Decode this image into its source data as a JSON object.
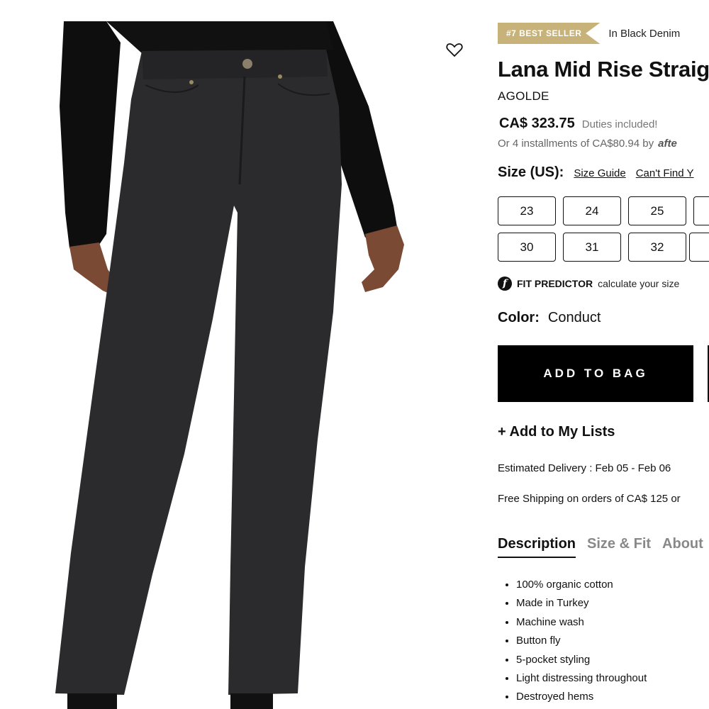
{
  "badge": {
    "label": "#7 BEST SELLER",
    "context": "In Black Denim"
  },
  "product": {
    "title": "Lana Mid Rise Straig",
    "brand": "AGOLDE",
    "price": "CA$ 323.75",
    "duties_note": "Duties included!",
    "installments": "Or 4 installments of CA$80.94 by",
    "installments_provider": "afte"
  },
  "size": {
    "label": "Size (US):",
    "guide_link": "Size Guide",
    "find_link": "Can't Find Y",
    "options": [
      "23",
      "24",
      "25",
      "",
      "30",
      "31",
      "32",
      ""
    ]
  },
  "fit_predictor": {
    "icon": "f",
    "title": "FIT PREDICTOR",
    "subtitle": "calculate your size"
  },
  "color": {
    "label": "Color:",
    "value": "Conduct"
  },
  "actions": {
    "add_to_bag": "ADD TO BAG",
    "add_to_lists": "+ Add to My Lists"
  },
  "delivery": "Estimated Delivery : Feb 05 - Feb 06",
  "shipping": "Free Shipping on orders of CA$ 125 or",
  "tabs": [
    "Description",
    "Size & Fit",
    "About"
  ],
  "description_items": [
    "100% organic cotton",
    "Made in Turkey",
    "Machine wash",
    "Button fly",
    "5-pocket styling",
    "Light distressing throughout",
    "Destroyed hems"
  ],
  "icons": {
    "wishlist": "heart-outline-icon",
    "fit": "fit-predictor-icon"
  },
  "colors": {
    "badge": "#c7b27a",
    "primary_button": "#000000",
    "denim": "#2b2b2d"
  }
}
